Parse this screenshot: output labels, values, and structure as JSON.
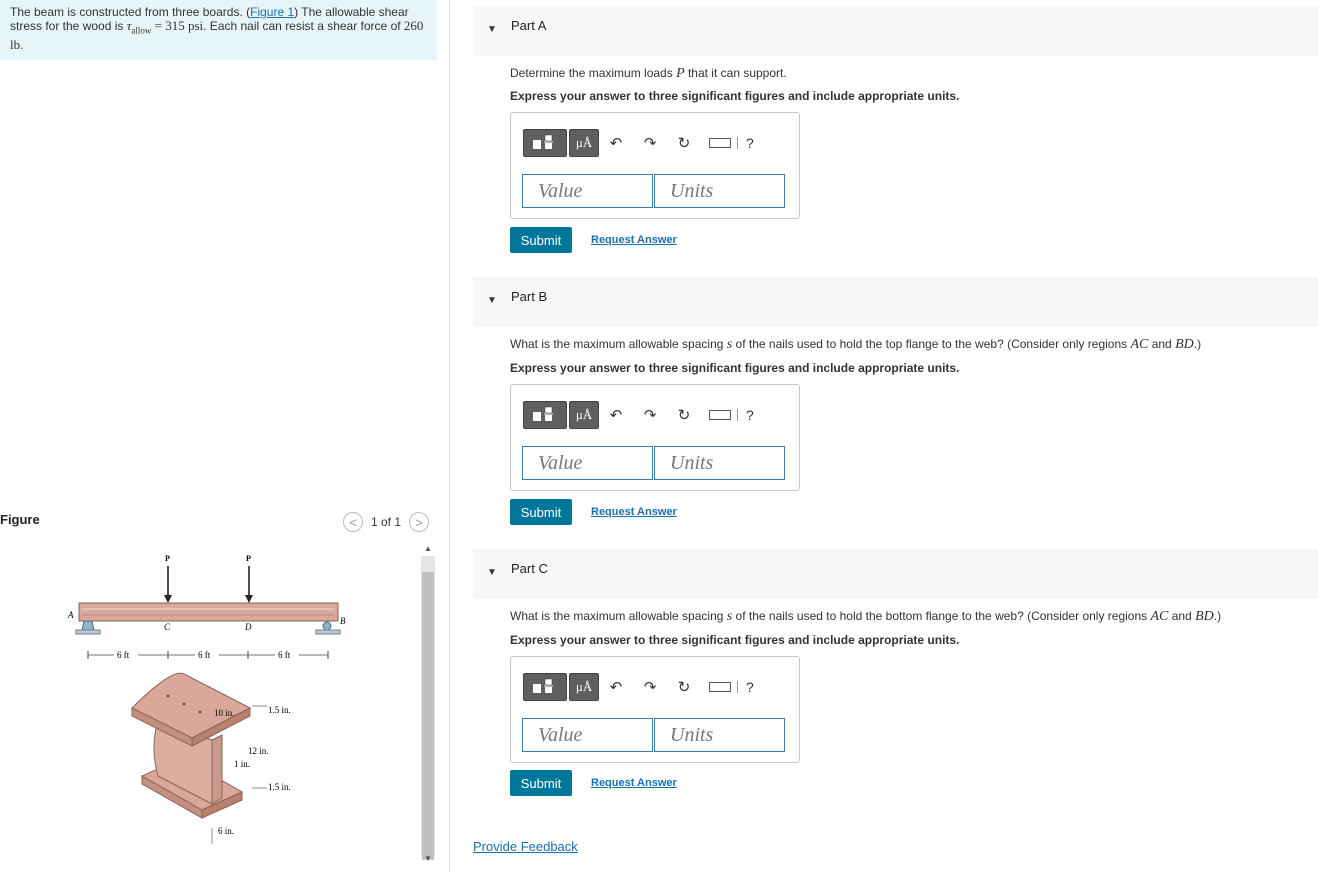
{
  "intro": {
    "text_1": "The beam is constructed from three boards. (",
    "figure_link": "Figure 1",
    "text_2": ") The allowable shear stress for the wood is ",
    "tau": "τ",
    "tau_sub": "allow",
    "tau_value": " = 315 psi",
    "text_3": ". Each nail can resist a shear force of ",
    "force": "260 lb",
    "text_4": "."
  },
  "figure": {
    "title": "Figure",
    "counter": "1 of 1",
    "prev": "<",
    "next": ">",
    "labels": {
      "P": "P",
      "A": "A",
      "B": "B",
      "C": "C",
      "D": "D",
      "span1": "6 ft",
      "span2": "6 ft",
      "span3": "6 ft",
      "d_10in": "10 in.",
      "d_15a": "1.5 in.",
      "d_12in": "12 in.",
      "d_1in": "1 in.",
      "d_15b": "1.5 in.",
      "d_6in": "6 in."
    }
  },
  "parts": [
    {
      "title": "Part A",
      "question_1": "Determine the maximum loads ",
      "question_var": "P",
      "question_2": " that it can support.",
      "instruction": "Express your answer to three significant figures and include appropriate units.",
      "value_placeholder": "Value",
      "units_placeholder": "Units",
      "submit": "Submit",
      "request": "Request Answer"
    },
    {
      "title": "Part B",
      "question_1": "What is the maximum allowable spacing ",
      "question_var": "s",
      "question_2": " of the nails used to hold the top flange to the web? (Consider only regions ",
      "region_1": "AC",
      "question_3": " and ",
      "region_2": "BD",
      "question_4": ".)",
      "instruction": "Express your answer to three significant figures and include appropriate units.",
      "value_placeholder": "Value",
      "units_placeholder": "Units",
      "submit": "Submit",
      "request": "Request Answer"
    },
    {
      "title": "Part C",
      "question_1": "What is the maximum allowable spacing ",
      "question_var": "s",
      "question_2": " of the nails used to hold the bottom flange to the web? (Consider only regions ",
      "region_1": "AC",
      "question_3": " and ",
      "region_2": "BD",
      "question_4": ".)",
      "instruction": "Express your answer to three significant figures and include appropriate units.",
      "value_placeholder": "Value",
      "units_placeholder": "Units",
      "submit": "Submit",
      "request": "Request Answer"
    }
  ],
  "toolbar": {
    "mu_label": "μÅ",
    "undo": "↶",
    "redo": "↷",
    "reset": "↻",
    "help": "?",
    "icons": [
      "templates-icon",
      "units-icon",
      "undo-icon",
      "redo-icon",
      "reset-icon",
      "keyboard-icon",
      "help-icon"
    ]
  },
  "feedback": "Provide Feedback",
  "colors": {
    "submit": "#00779a",
    "link": "#1a6fb0",
    "intro_bg": "#e8f5f8",
    "field_border": "#3a7da8"
  }
}
